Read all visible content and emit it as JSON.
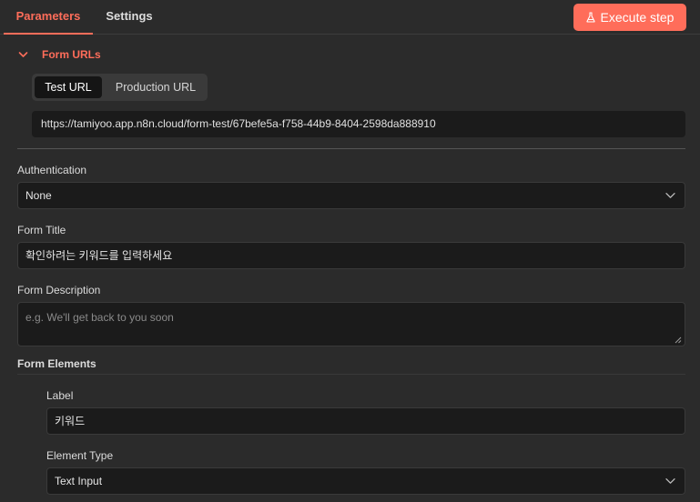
{
  "tabs": {
    "parameters": "Parameters",
    "settings": "Settings"
  },
  "execute_button": {
    "label": "Execute step",
    "icon": "flask-icon",
    "color": "#ff6d5a"
  },
  "form_urls": {
    "title": "Form URLs",
    "test_label": "Test URL",
    "production_label": "Production URL",
    "url": "https://tamiyoo.app.n8n.cloud/form-test/67befe5a-f758-44b9-8404-2598da888910"
  },
  "authentication": {
    "label": "Authentication",
    "value": "None"
  },
  "form_title": {
    "label": "Form Title",
    "value": "확인하려는 키워드를 입력하세요"
  },
  "form_description": {
    "label": "Form Description",
    "placeholder": "e.g. We'll get back to you soon",
    "value": ""
  },
  "form_elements": {
    "title": "Form Elements",
    "item": {
      "label_caption": "Label",
      "label_value": "키워드",
      "type_caption": "Element Type",
      "type_value": "Text Input"
    }
  },
  "colors": {
    "accent": "#ff6d5a",
    "background": "#2b2b2b",
    "input_bg": "#1b1b1b"
  }
}
